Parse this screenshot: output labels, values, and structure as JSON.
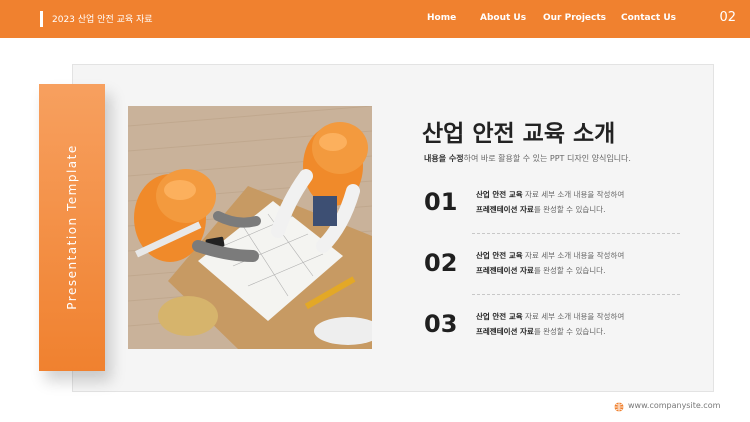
{
  "header": {
    "doc_title": "2023 산업 안전 교육 자료",
    "nav": [
      "Home",
      "About Us",
      "Our Projects",
      "Contact Us"
    ],
    "page_number": "02"
  },
  "side_label": "Presentation Template",
  "main": {
    "title": "산업 안전 교육 소개",
    "subtitle_bold": "내용을 수정",
    "subtitle_rest": "하여 바로 활용할 수 있는 PPT 디자인 양식입니다.",
    "items": [
      {
        "number": "01",
        "line1_bold": "산업 안전 교육",
        "line1_rest": " 자료 세부 소개 내용을 작성하여",
        "line2_bold": "프레젠테이션 자료",
        "line2_rest": "를 완성할 수 있습니다."
      },
      {
        "number": "02",
        "line1_bold": "산업 안전 교육",
        "line1_rest": " 자료 세부 소개 내용을 작성하여",
        "line2_bold": "프레젠테이션 자료",
        "line2_rest": "를 완성할 수 있습니다."
      },
      {
        "number": "03",
        "line1_bold": "산업 안전 교육",
        "line1_rest": " 자료 세부 소개 내용을 작성하여",
        "line2_bold": "프레젠테이션 자료",
        "line2_rest": "를 완성할 수 있습니다."
      }
    ]
  },
  "footer": {
    "url": "www.companysite.com",
    "icon": "globe-icon"
  },
  "colors": {
    "accent": "#f0812f",
    "accent_light": "#f7a05f",
    "panel_bg": "#f5f5f5"
  }
}
